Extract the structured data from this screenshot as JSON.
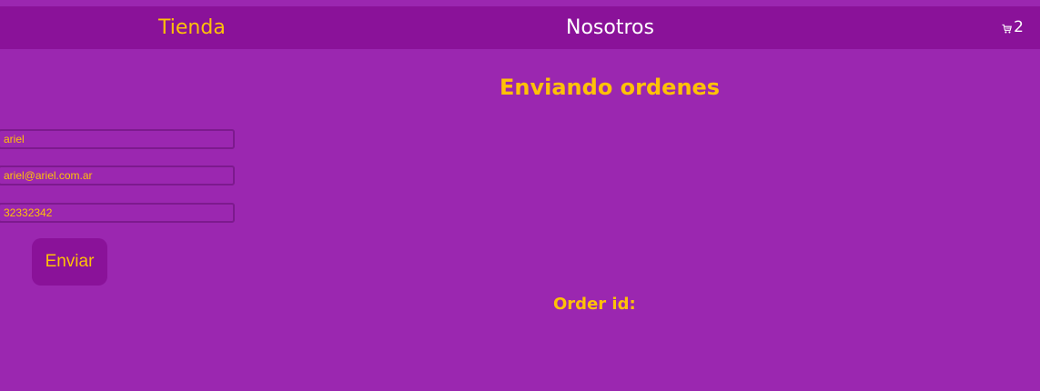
{
  "nav": {
    "tienda_label": "Tienda",
    "nosotros_label": "Nosotros",
    "cart_count": "2",
    "cart_icon": "cart-icon"
  },
  "form": {
    "name_value": "ariel",
    "email_value": "ariel@ariel.com.ar",
    "phone_value": "32332342",
    "submit_label": "Enviar"
  },
  "main": {
    "heading": "Enviando ordenes",
    "order_id_label": "Order id:"
  },
  "colors": {
    "background": "#9b27b0",
    "navbar": "#8a1299",
    "accent": "#ffc107",
    "text_light": "#ffffff"
  }
}
